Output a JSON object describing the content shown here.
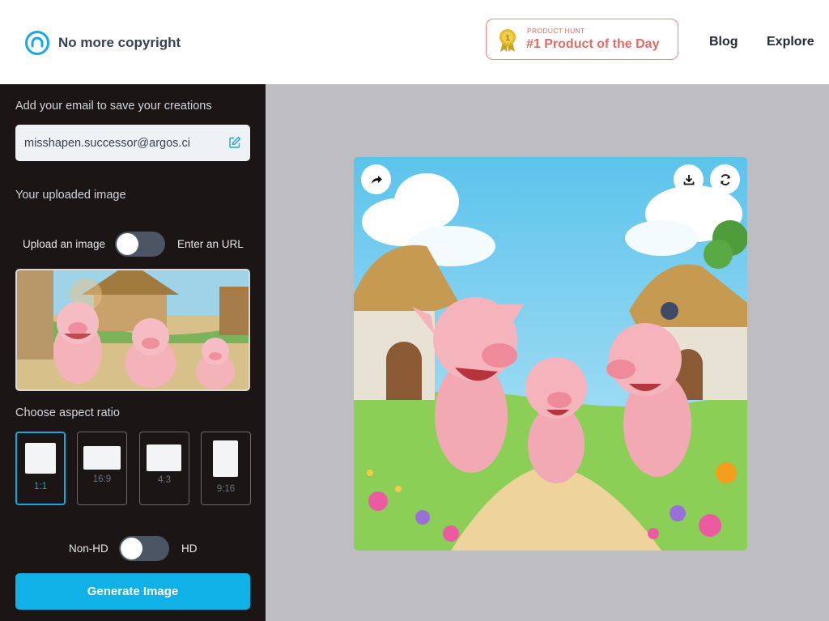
{
  "header": {
    "brand_name": "No more copyright",
    "badge": {
      "small": "PRODUCT HUNT",
      "big": "#1 Product of the Day",
      "medal_number": "1"
    },
    "nav": {
      "blog": "Blog",
      "explore": "Explore"
    }
  },
  "sidebar": {
    "email_label": "Add your email to save your creations",
    "email_value": "misshapen.successor@argos.ci",
    "uploaded_label": "Your uploaded image",
    "upload_toggle": {
      "left": "Upload an image",
      "right": "Enter an URL",
      "checked": false
    },
    "aspect_label": "Choose aspect ratio",
    "ratios": [
      "1:1",
      "16:9",
      "4:3",
      "9:16"
    ],
    "selected_ratio": "1:1",
    "hd_toggle": {
      "left": "Non-HD",
      "right": "HD",
      "checked": false
    },
    "generate_label": "Generate Image"
  },
  "main": {
    "actions": [
      "share-icon",
      "download-icon",
      "refresh-icon"
    ]
  },
  "colors": {
    "accent": "#0fb1e6",
    "sidebar_bg": "#1b1516",
    "main_bg": "#bdbdc2",
    "badge": "#e06b68"
  }
}
